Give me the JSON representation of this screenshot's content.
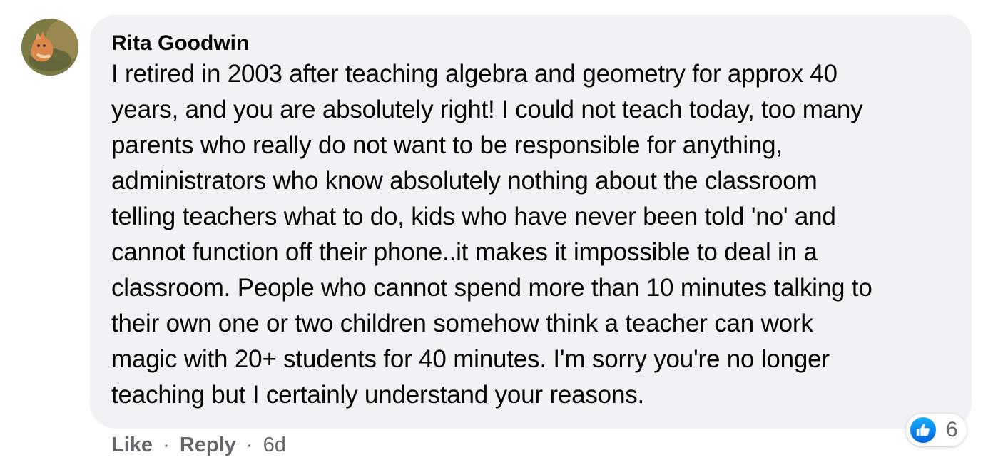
{
  "comment": {
    "author": "Rita Goodwin",
    "lines": [
      "I retired in 2003 after teaching algebra and geometry for approx 40",
      "years, and you are absolutely right! I could not teach today, too many",
      "parents who really do not want to be responsible for anything,",
      "administrators who know absolutely nothing about the classroom",
      "telling teachers what to do, kids who have never been told 'no' and",
      "cannot function off their phone..it makes it impossible to deal in a",
      "classroom. People who cannot spend more than 10 minutes talking to",
      "their own one or two children somehow think a teacher can work",
      "magic with 20+ students for 40 minutes. I'm sorry you're no longer",
      "teaching but I certainly understand your reasons."
    ],
    "avatar_icon": "profile-photo-cat"
  },
  "actions": {
    "like_label": "Like",
    "separator": "·",
    "reply_label": "Reply",
    "timestamp": "6d"
  },
  "reactions": {
    "icon": "thumbs-up-icon",
    "count": "6",
    "color": "#1877f2"
  },
  "colors": {
    "bubble": "#f0f2f5",
    "secondary_text": "#65676b",
    "primary_text": "#050505"
  }
}
